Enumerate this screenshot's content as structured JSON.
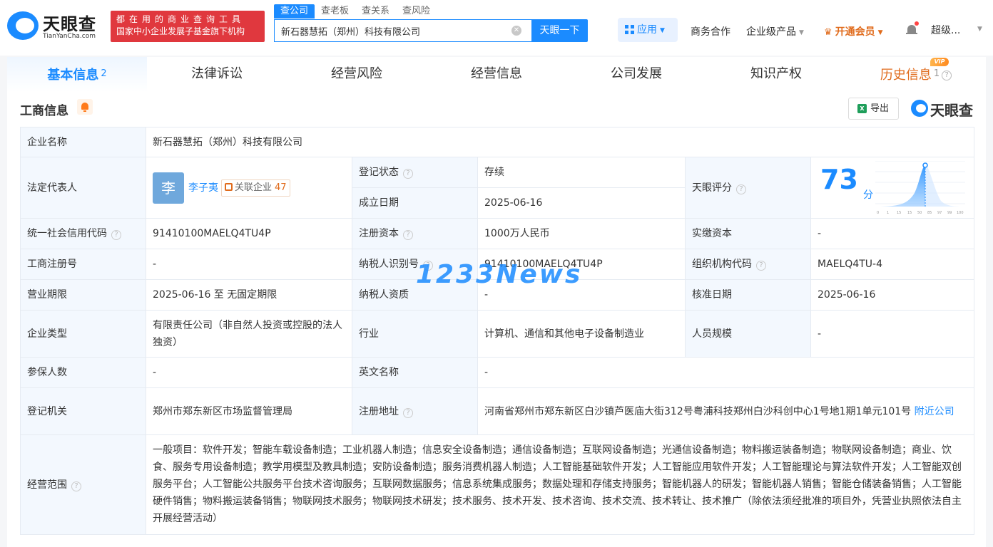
{
  "header": {
    "logo_text": "天眼查",
    "logo_sub": "TianYanCha.com",
    "slogan_line1": "都在用的商业查询工具",
    "slogan_line2": "国家中小企业发展子基金旗下机构",
    "search_tabs": [
      "查公司",
      "查老板",
      "查关系",
      "查风险"
    ],
    "search_value": "新石器慧拓（郑州）科技有限公司",
    "search_button": "天眼一下",
    "apps": "应用",
    "business": "商务合作",
    "enterprise": "企业级产品",
    "vip": "开通会员",
    "user": "超级..."
  },
  "tabs": [
    {
      "label": "基本信息",
      "count": "2"
    },
    {
      "label": "法律诉讼",
      "count": ""
    },
    {
      "label": "经营风险",
      "count": ""
    },
    {
      "label": "经营信息",
      "count": ""
    },
    {
      "label": "公司发展",
      "count": ""
    },
    {
      "label": "知识产权",
      "count": ""
    },
    {
      "label": "历史信息",
      "count": "1"
    }
  ],
  "vip_badge": "VIP",
  "section": {
    "title": "工商信息",
    "export": "导出",
    "brand": "天眼查"
  },
  "info": {
    "company_name_label": "企业名称",
    "company_name": "新石器慧拓（郑州）科技有限公司",
    "legal_rep_label": "法定代表人",
    "legal_rep_avatar": "李",
    "legal_rep_name": "李子夷",
    "related_label": "关联企业",
    "related_count": "47",
    "reg_status_label": "登记状态",
    "reg_status": "存续",
    "est_date_label": "成立日期",
    "est_date": "2025-06-16",
    "score_label": "天眼评分",
    "score": "73",
    "score_unit": "分",
    "score_ticks": [
      "0",
      "1",
      "15",
      "15",
      "50",
      "85",
      "97",
      "99",
      "100"
    ],
    "credit_code_label": "统一社会信用代码",
    "credit_code": "91410100MAELQ4TU4P",
    "reg_capital_label": "注册资本",
    "reg_capital": "1000万人民币",
    "paid_capital_label": "实缴资本",
    "paid_capital": "-",
    "reg_no_label": "工商注册号",
    "reg_no": "-",
    "taxpayer_id_label": "纳税人识别号",
    "taxpayer_id": "91410100MAELQ4TU4P",
    "org_code_label": "组织机构代码",
    "org_code": "MAELQ4TU-4",
    "term_label": "营业期限",
    "term": "2025-06-16 至 无固定期限",
    "taxpayer_qual_label": "纳税人资质",
    "taxpayer_qual": "-",
    "approve_date_label": "核准日期",
    "approve_date": "2025-06-16",
    "type_label": "企业类型",
    "type_value": "有限责任公司（非自然人投资或控股的法人独资）",
    "industry_label": "行业",
    "industry": "计算机、通信和其他电子设备制造业",
    "staff_label": "人员规模",
    "staff": "-",
    "insured_label": "参保人数",
    "insured": "-",
    "english_label": "英文名称",
    "english": "-",
    "authority_label": "登记机关",
    "authority": "郑州市郑东新区市场监督管理局",
    "address_label": "注册地址",
    "address": "河南省郑州市郑东新区白沙镇芦医庙大街312号粤浦科技郑州白沙科创中心1号地1期1单元101号",
    "nearby": "附近公司",
    "scope_label": "经营范围",
    "scope": "一般项目：软件开发；智能车载设备制造；工业机器人制造；信息安全设备制造；通信设备制造；互联网设备制造；光通信设备制造；物料搬运装备制造；物联网设备制造；商业、饮食、服务专用设备制造；教学用模型及教具制造；安防设备制造；服务消费机器人制造；人工智能基础软件开发；人工智能应用软件开发；人工智能理论与算法软件开发；人工智能双创服务平台；人工智能公共服务平台技术咨询服务；互联网数据服务；信息系统集成服务；数据处理和存储支持服务；智能机器人的研发；智能机器人销售；智能仓储装备销售；人工智能硬件销售；物料搬运装备销售；物联网技术服务；物联网技术研发；技术服务、技术开发、技术咨询、技术交流、技术转让、技术推广（除依法须经批准的项目外，凭营业执照依法自主开展经营活动）"
  },
  "watermark": "1233News",
  "colors": {
    "accent": "#1b8bff",
    "status_green": "#1aa35a",
    "vip_orange": "#e06b1c",
    "slogan_red": "#e0383e"
  }
}
